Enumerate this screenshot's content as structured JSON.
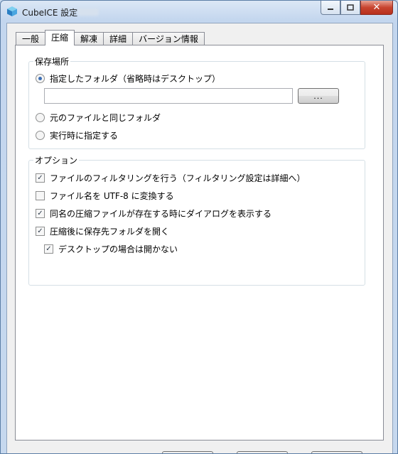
{
  "window": {
    "title": "CubeICE 設定",
    "controls": {
      "minimize": "▭",
      "maximize": "▢",
      "close": "✕"
    }
  },
  "tabs": [
    {
      "label": "一般",
      "active": false
    },
    {
      "label": "圧縮",
      "active": true
    },
    {
      "label": "解凍",
      "active": false
    },
    {
      "label": "詳細",
      "active": false
    },
    {
      "label": "バージョン情報",
      "active": false
    }
  ],
  "save_location": {
    "legend": "保存場所",
    "options": [
      {
        "label": "指定したフォルダ（省略時はデスクトップ）",
        "selected": true
      },
      {
        "label": "元のファイルと同じフォルダ",
        "selected": false
      },
      {
        "label": "実行時に指定する",
        "selected": false
      }
    ],
    "folder_path": "",
    "browse_label": "..."
  },
  "options": {
    "legend": "オプション",
    "items": [
      {
        "label": "ファイルのフィルタリングを行う（フィルタリング設定は詳細へ）",
        "checked": true
      },
      {
        "label": "ファイル名を UTF-8 に変換する",
        "checked": false
      },
      {
        "label": "同名の圧縮ファイルが存在する時にダイアログを表示する",
        "checked": true
      },
      {
        "label": "圧縮後に保存先フォルダを開く",
        "checked": true
      },
      {
        "label": "デスクトップの場合は開かない",
        "checked": true
      }
    ]
  },
  "icons": {
    "app": "cube-icon",
    "check": "✓"
  },
  "colors": {
    "radio_dot": "#3b6eb5",
    "title_bar": "#c3d6ee",
    "close_button": "#c8442f"
  }
}
